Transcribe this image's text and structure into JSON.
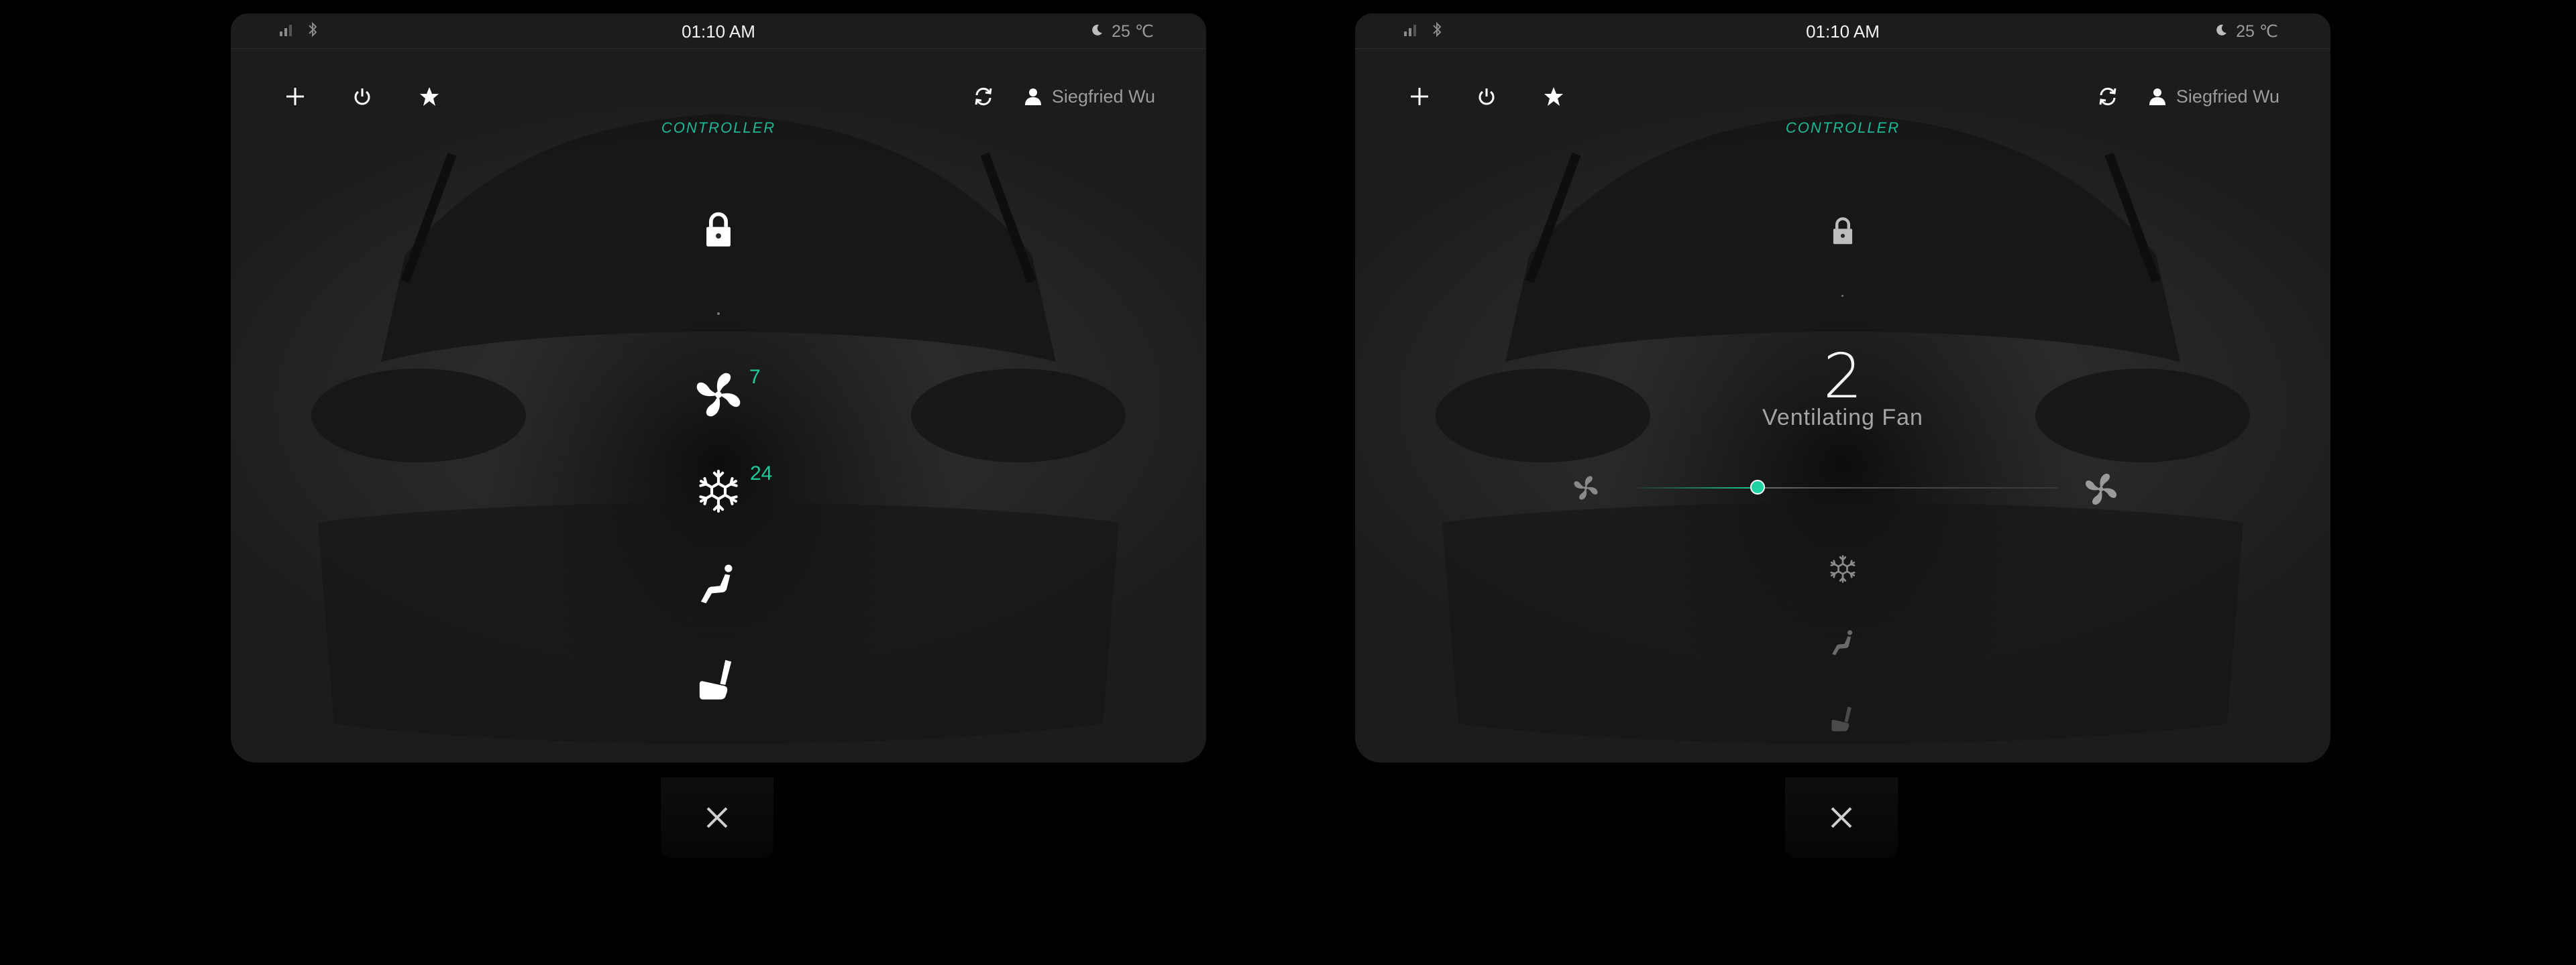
{
  "screens": [
    {
      "state": "overview",
      "status": {
        "time": "01:10 AM",
        "temperature": "25 ℃",
        "signal_icon": "signal-icon",
        "bluetooth_icon": "bluetooth-icon",
        "weather_icon": "moon-icon"
      },
      "toolbar": {
        "add_icon": "plus-icon",
        "power_icon": "power-icon",
        "favorite_icon": "star-icon",
        "refresh_icon": "refresh-icon"
      },
      "user": {
        "name": "Siegfried Wu"
      },
      "section_label": "CONTROLLER",
      "controls": {
        "lock": {
          "icon": "lock-icon"
        },
        "fan": {
          "icon": "fan-icon",
          "value": "7"
        },
        "ac": {
          "icon": "snowflake-icon",
          "value": "24"
        },
        "seat_recline": {
          "icon": "seat-recline-icon"
        },
        "seat_heat": {
          "icon": "seat-icon"
        }
      },
      "close_icon": "close-icon"
    },
    {
      "state": "fan-adjust",
      "status": {
        "time": "01:10 AM",
        "temperature": "25 ℃",
        "signal_icon": "signal-icon",
        "bluetooth_icon": "bluetooth-icon",
        "weather_icon": "moon-icon"
      },
      "toolbar": {
        "add_icon": "plus-icon",
        "power_icon": "power-icon",
        "favorite_icon": "star-icon",
        "refresh_icon": "refresh-icon"
      },
      "user": {
        "name": "Siegfried Wu"
      },
      "section_label": "CONTROLLER",
      "fan_level": {
        "value": "2",
        "label": "Ventilating Fan",
        "slider_fraction": 0.3
      },
      "controls": {
        "lock": {
          "icon": "lock-icon"
        },
        "ac": {
          "icon": "snowflake-icon"
        },
        "seat_recline": {
          "icon": "seat-recline-icon"
        },
        "seat_heat": {
          "icon": "seat-icon"
        }
      },
      "close_icon": "close-icon"
    }
  ],
  "colors": {
    "accent": "#1fca9b",
    "background": "#000000",
    "panel": "#2a2a2a",
    "muted_text": "#9c9c9c"
  }
}
